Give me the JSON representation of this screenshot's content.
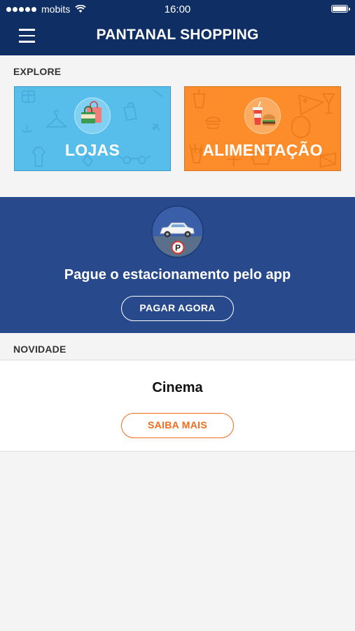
{
  "status_bar": {
    "carrier": "mobits",
    "time": "16:00"
  },
  "header": {
    "title": "PANTANAL SHOPPING",
    "menu_icon": "hamburger-menu-icon"
  },
  "explore": {
    "section_label": "EXPLORE",
    "tiles": [
      {
        "label": "LOJAS",
        "icon": "shopping-bags-icon",
        "color": "#57bdea"
      },
      {
        "label": "ALIMENTAÇÃO",
        "icon": "food-drink-icon",
        "color": "#fd8d2a"
      }
    ]
  },
  "parking": {
    "icon": "car-parking-icon",
    "text": "Pague o estacionamento pelo app",
    "button_label": "PAGAR AGORA",
    "color": "#284a8c"
  },
  "novidade": {
    "section_label": "NOVIDADE",
    "title": "Cinema",
    "button_label": "SAIBA MAIS",
    "accent": "#f26a1b"
  }
}
